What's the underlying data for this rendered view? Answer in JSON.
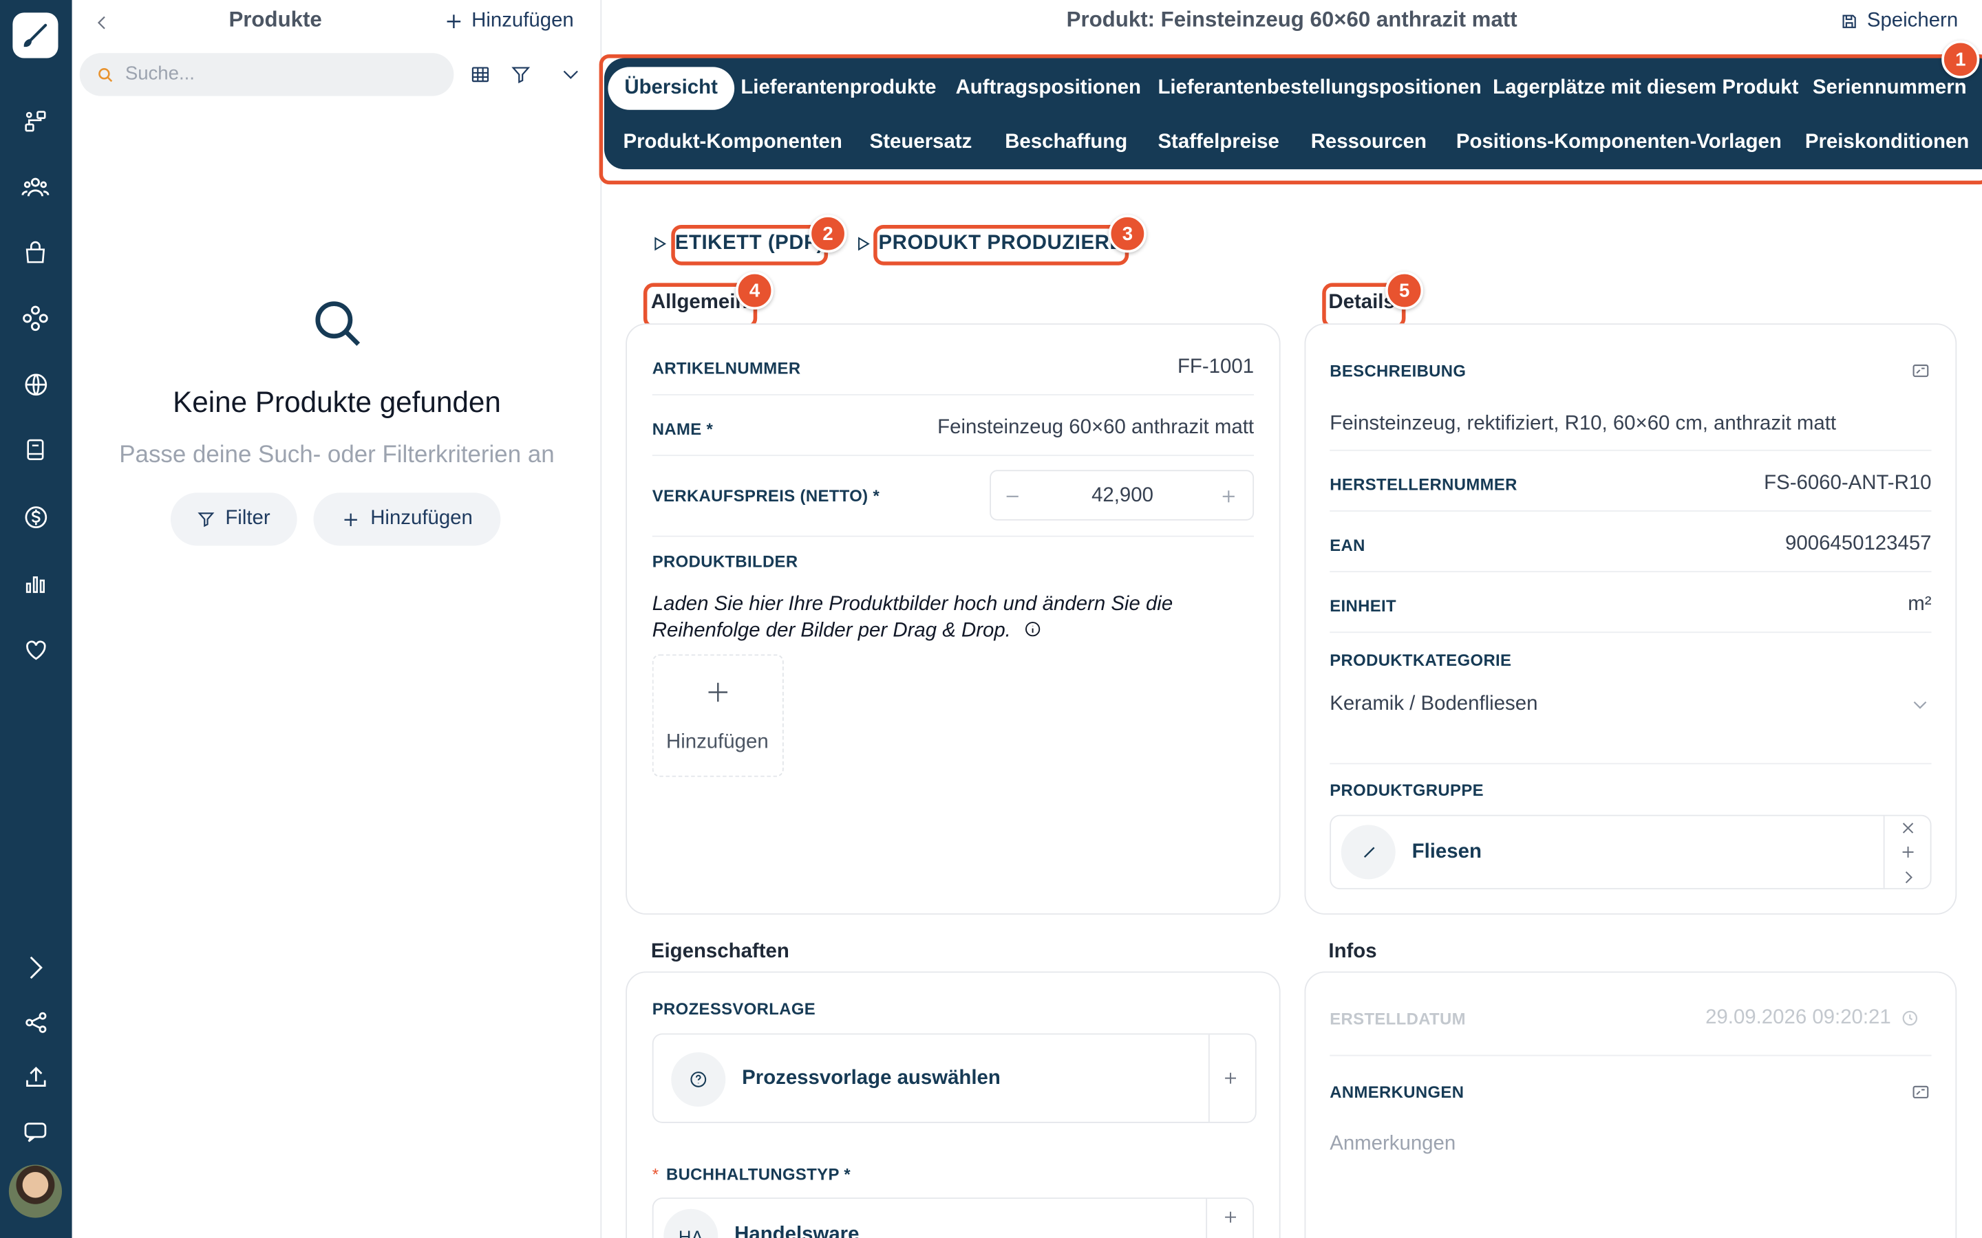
{
  "rail": {
    "icons": [
      "brush-logo-icon",
      "flow-icon",
      "users-icon",
      "shopping-bag-icon",
      "components-icon",
      "globe-icon",
      "book-icon",
      "dollar-icon",
      "bar-chart-icon",
      "heart-icon",
      "chevron-right-icon",
      "share-icon",
      "upload-icon",
      "chat-icon"
    ]
  },
  "list": {
    "title": "Produkte",
    "add_label": "Hinzufügen",
    "search_placeholder": "Suche...",
    "empty_title": "Keine Produkte gefunden",
    "empty_subtitle": "Passe deine Such- oder Filterkriterien an",
    "filter_button": "Filter",
    "add_button": "Hinzufügen"
  },
  "detail": {
    "title": "Produkt: Feinsteinzeug 60×60 anthrazit matt",
    "save_label": "Speichern",
    "tabs_row1": [
      "Übersicht",
      "Lieferantenprodukte",
      "Auftragspositionen",
      "Lieferantenbestellungspositionen",
      "Lagerplätze mit diesem Produkt",
      "Seriennummern"
    ],
    "tabs_row2": [
      "Produkt-Komponenten",
      "Steuersatz",
      "Beschaffung",
      "Staffelpreise",
      "Ressourcen",
      "Positions-Komponenten-Vorlagen",
      "Preiskonditionen"
    ],
    "actions": [
      "ETIKETT (PDF)",
      "PRODUKT PRODUZIEREN"
    ],
    "badges": [
      "1",
      "2",
      "3",
      "4",
      "5"
    ],
    "allgemein": {
      "title": "Allgemein",
      "artikelnummer_label": "ARTIKELNUMMER",
      "artikelnummer": "FF-1001",
      "name_label": "NAME *",
      "name": "Feinsteinzeug 60×60 anthrazit matt",
      "preis_label": "VERKAUFSPREIS (NETTO) *",
      "preis": "42,900",
      "bilder_label": "PRODUKTBILDER",
      "bilder_hint": "Laden Sie hier Ihre Produktbilder hoch und ändern Sie die Reihenfolge der Bilder per Drag & Drop.",
      "bilder_add": "Hinzufügen"
    },
    "details": {
      "title": "Details",
      "beschreibung_label": "BESCHREIBUNG",
      "beschreibung": "Feinsteinzeug, rektifiziert, R10, 60×60 cm, anthrazit matt",
      "herstellernummer_label": "HERSTELLERNUMMER",
      "herstellernummer": "FS-6060-ANT-R10",
      "ean_label": "EAN",
      "ean": "9006450123457",
      "einheit_label": "EINHEIT",
      "einheit": "m²",
      "kategorie_label": "PRODUKTKATEGORIE",
      "kategorie": "Keramik / Bodenfliesen",
      "gruppe_label": "PRODUKTGRUPPE",
      "gruppe": "Fliesen"
    },
    "eigenschaften": {
      "title": "Eigenschaften",
      "prozess_label": "PROZESSVORLAGE",
      "prozess_placeholder": "Prozessvorlage auswählen",
      "buchhaltung_label": "BUCHHALTUNGSTYP *",
      "buchhaltung_required_mark": "*",
      "buchhaltung_initials": "HA",
      "buchhaltung_value": "Handelsware"
    },
    "infos": {
      "title": "Infos",
      "erstelldatum_label": "ERSTELLDATUM",
      "erstelldatum": "29.09.2026 09:20:21",
      "anmerkungen_label": "ANMERKUNGEN",
      "anmerkungen_placeholder": "Anmerkungen"
    }
  }
}
